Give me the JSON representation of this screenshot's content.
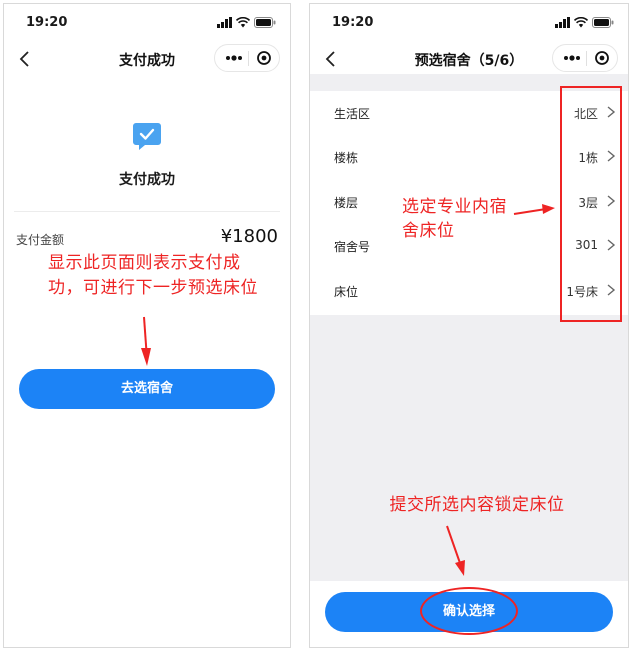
{
  "status_bar": {
    "time": "19:20"
  },
  "left_screen": {
    "nav_title": "支付成功",
    "success_text": "支付成功",
    "amount_label": "支付金额",
    "amount_value": "¥1800",
    "annotation": "显示此页面则表示支付成功，可进行下一步预选床位",
    "button_label": "去选宿舍"
  },
  "right_screen": {
    "nav_title": "预选宿舍（5/6）",
    "rows": [
      {
        "label": "生活区",
        "value": "北区"
      },
      {
        "label": "楼栋",
        "value": "1栋"
      },
      {
        "label": "楼层",
        "value": "3层"
      },
      {
        "label": "宿舍号",
        "value": "301"
      },
      {
        "label": "床位",
        "value": "1号床"
      }
    ],
    "annotation_select": "选定专业内宿舍床位",
    "annotation_submit": "提交所选内容锁定床位",
    "button_label": "确认选择"
  },
  "colors": {
    "accent": "#1c83f6",
    "annotation": "#ee2424",
    "background_gray": "#efeff2"
  },
  "icons": [
    "back-arrow-icon",
    "more-dots-icon",
    "target-icon",
    "check-bubble-icon",
    "chevron-right-icon",
    "signal-icon",
    "wifi-icon",
    "battery-icon"
  ]
}
